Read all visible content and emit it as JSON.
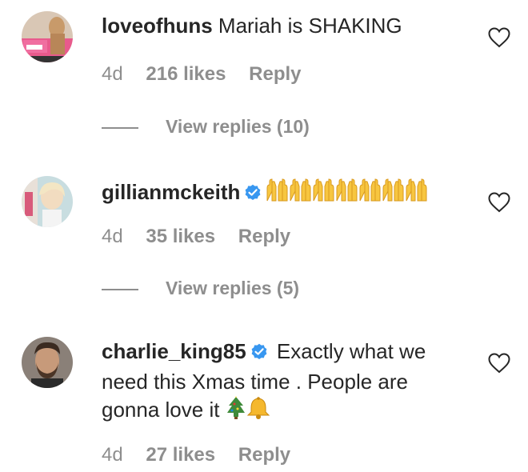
{
  "comments": [
    {
      "username": "loveofhuns",
      "verified": false,
      "text": "Mariah is SHAKING",
      "time": "4d",
      "likes": "216 likes",
      "reply_label": "Reply",
      "view_replies": "View replies (10)"
    },
    {
      "username": "gillianmckeith",
      "verified": true,
      "text": "",
      "emoji": "raising-hands x7",
      "time": "4d",
      "likes": "35 likes",
      "reply_label": "Reply",
      "view_replies": "View replies (5)"
    },
    {
      "username": "charlie_king85",
      "verified": true,
      "text": "Exactly what we need this Xmas time . People are gonna love it",
      "emoji": "christmas-tree bell",
      "time": "4d",
      "likes": "27 likes",
      "reply_label": "Reply"
    }
  ],
  "colors": {
    "text": "#262626",
    "muted": "#8e8e8e",
    "verified_blue": "#3897f0"
  }
}
